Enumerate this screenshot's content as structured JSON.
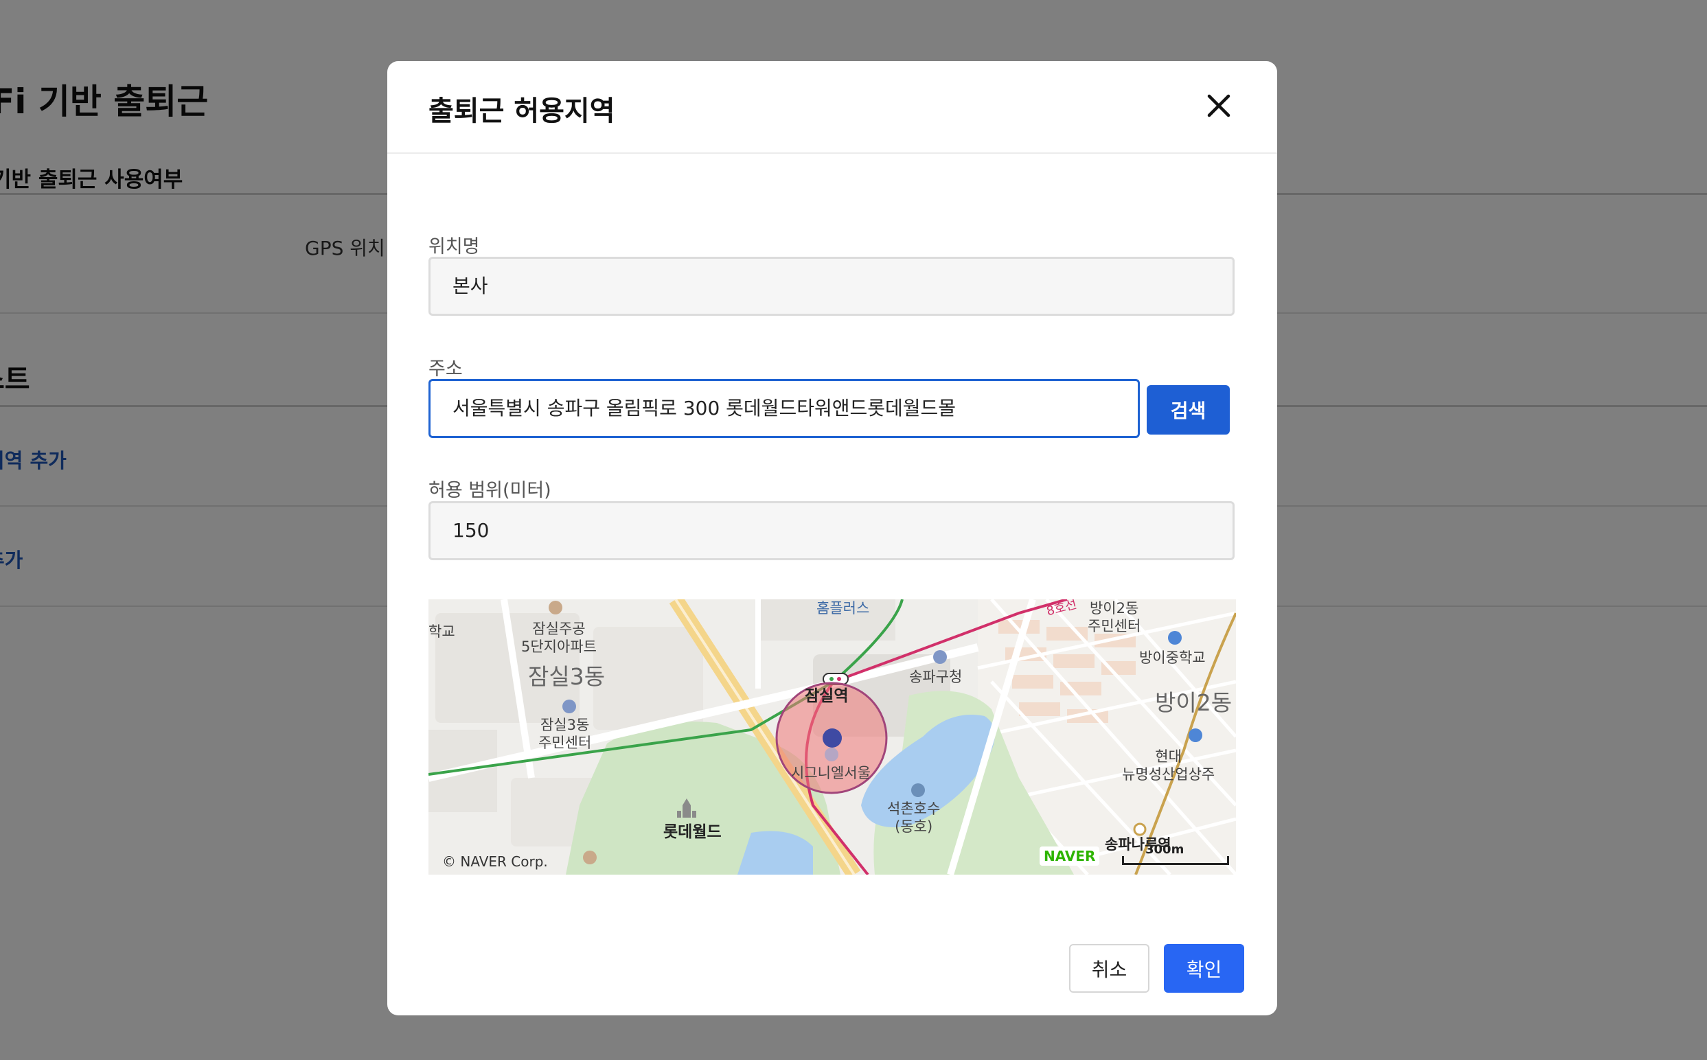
{
  "background": {
    "page_title": "iFi 기반 출퇴근",
    "section_title": "기반 출퇴근 사용여부",
    "gps_label": "GPS 위치",
    "list_title": "스트",
    "add_area_link": "지역 추가",
    "add_link": "추가"
  },
  "modal": {
    "title": "출퇴근 허용지역",
    "location_name": {
      "label": "위치명",
      "value": "본사"
    },
    "address": {
      "label": "주소",
      "value": "서울특별시 송파구 올림픽로 300 롯데월드타워앤드롯데월드몰",
      "search_label": "검색"
    },
    "range": {
      "label": "허용 범위(미터)",
      "value": "150"
    },
    "map": {
      "labels": {
        "jamsil_apt": "잠실주공\n5단지아파트",
        "jamsil3dong": "잠실3동",
        "jamsil3_center": "잠실3동\n주민센터",
        "homeplus": "홈플러스",
        "jamsil_station": "잠실역",
        "songpa_office": "송파구청",
        "bangi2_center": "방이2동\n주민센터",
        "bangi_middle": "방이중학교",
        "bangi2dong": "방이2동",
        "hyundai": "현대\n뉴명성산업상주",
        "signiel": "시그니엘서울",
        "seokchon_lake": "석촌호수\n(동호)",
        "lotte_world": "롯데월드",
        "songpa_naru": "송파나루역",
        "line8": "8호선",
        "school": "학교"
      },
      "copyright": "© NAVER Corp.",
      "logo": "NAVER",
      "scale": "300m"
    },
    "cancel_label": "취소",
    "confirm_label": "확인"
  }
}
